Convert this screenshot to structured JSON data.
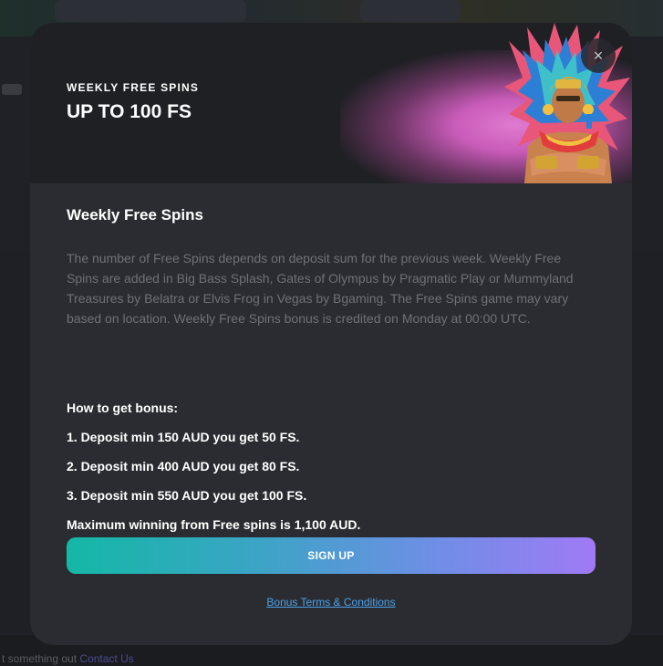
{
  "background": {
    "footer_text": "t something out",
    "footer_link": "Contact Us"
  },
  "modal": {
    "banner": {
      "eyebrow": "WEEKLY FREE SPINS",
      "title": "UP TO 100 FS"
    },
    "close_icon": "×",
    "section_title": "Weekly Free Spins",
    "description": "The number of Free Spins depends on deposit sum for the previous week. Weekly Free Spins are added in Big Bass Splash, Gates of Olympus by Pragmatic Play or Mummyland Treasures by Belatra or Elvis Frog in Vegas by Bgaming. The Free Spins game may vary based on location. Weekly Free Spins bonus is credited on Monday at 00:00 UTC.",
    "how_title": "How to get bonus:",
    "steps": [
      "1. Deposit min 150 AUD you get 50 FS.",
      "2. Deposit min 400 AUD you get 80 FS.",
      "3. Deposit min 550 AUD you get 100 FS.",
      "Maximum winning from Free spins is 1,100 AUD."
    ],
    "signup_label": "SIGN UP",
    "terms_label": "Bonus Terms & Conditions"
  },
  "colors": {
    "modal_bg": "#2b2c31",
    "accent_start": "#14b8a6",
    "accent_end": "#a07af5",
    "link": "#4ba3ea"
  }
}
